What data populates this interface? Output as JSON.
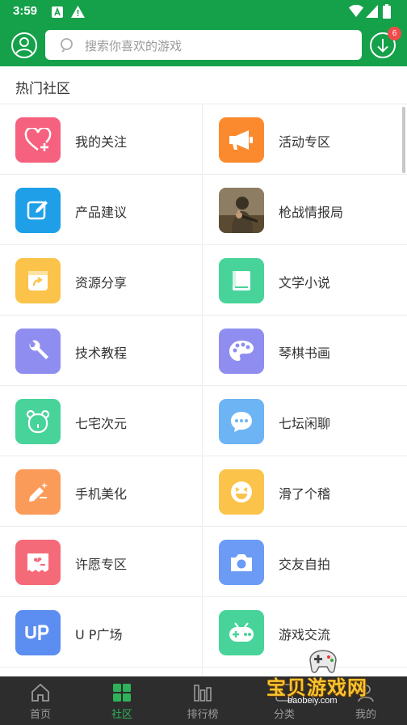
{
  "status_bar": {
    "time": "3:59"
  },
  "header": {
    "search_placeholder": "搜索你喜欢的游戏",
    "download_badge": "6"
  },
  "section": {
    "title": "热门社区"
  },
  "categories": [
    {
      "label": "我的关注",
      "icon": "heart-plus-icon",
      "color": "#f5617e"
    },
    {
      "label": "活动专区",
      "icon": "megaphone-icon",
      "color": "#fb8a2e"
    },
    {
      "label": "产品建议",
      "icon": "edit-icon",
      "color": "#1e9fe8"
    },
    {
      "label": "枪战情报局",
      "icon": "soldier-thumbnail",
      "color": "#6b5a3e"
    },
    {
      "label": "资源分享",
      "icon": "share-box-icon",
      "color": "#fbc34a"
    },
    {
      "label": "文学小说",
      "icon": "book-icon",
      "color": "#47d39a"
    },
    {
      "label": "技术教程",
      "icon": "wrench-icon",
      "color": "#8f8ef0"
    },
    {
      "label": "琴棋书画",
      "icon": "palette-icon",
      "color": "#8f8ef0"
    },
    {
      "label": "七宅次元",
      "icon": "bear-icon",
      "color": "#47d39a"
    },
    {
      "label": "七坛闲聊",
      "icon": "chat-bubble-icon",
      "color": "#6db4f5"
    },
    {
      "label": "手机美化",
      "icon": "pen-sparkle-icon",
      "color": "#fb9b5a"
    },
    {
      "label": "滑了个稽",
      "icon": "laugh-face-icon",
      "color": "#fbc34a"
    },
    {
      "label": "许愿专区",
      "icon": "wish-card-icon",
      "color": "#f56a78"
    },
    {
      "label": "交友自拍",
      "icon": "camera-icon",
      "color": "#6b9bf5"
    },
    {
      "label": "U P广场",
      "icon": "up-icon",
      "color": "#5b8ef0"
    },
    {
      "label": "游戏交流",
      "icon": "gamepad-icon",
      "color": "#47d39a"
    }
  ],
  "tabbar": {
    "items": [
      {
        "label": "首页",
        "icon": "home-icon"
      },
      {
        "label": "社区",
        "icon": "grid-icon",
        "active": true
      },
      {
        "label": "排行榜",
        "icon": "bar-chart-icon"
      },
      {
        "label": "分类",
        "icon": "category-icon"
      },
      {
        "label": "我的",
        "icon": "user-icon"
      }
    ]
  },
  "watermark": {
    "text": "宝贝游戏网",
    "url": "baobeiy.com"
  }
}
